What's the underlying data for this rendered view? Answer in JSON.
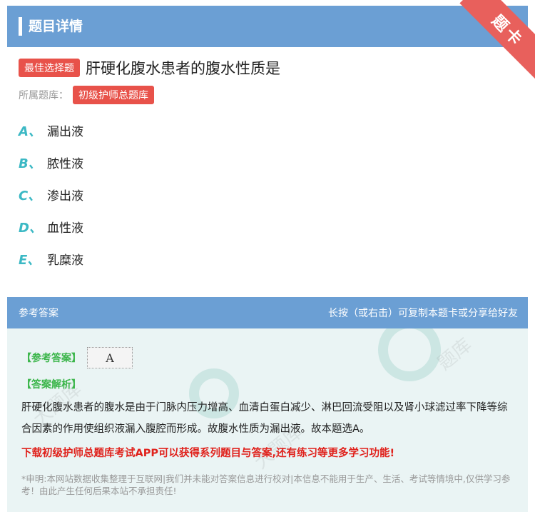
{
  "header": {
    "title": "题目详情",
    "corner_badge": "题卡"
  },
  "question": {
    "type_tag": "最佳选择题",
    "text": "肝硬化腹水患者的腹水性质是",
    "bank_label": "所属题库：",
    "bank_name": "初级护师总题库"
  },
  "options": [
    {
      "letter": "A、",
      "text": "漏出液"
    },
    {
      "letter": "B、",
      "text": "脓性液"
    },
    {
      "letter": "C、",
      "text": "渗出液"
    },
    {
      "letter": "D、",
      "text": "血性液"
    },
    {
      "letter": "E、",
      "text": "乳糜液"
    }
  ],
  "answer_section": {
    "title": "参考答案",
    "hint": "长按（或右击）可复制本题卡或分享给好友",
    "answer_label": "【参考答案】",
    "answer_value": "A",
    "analysis_label": "【答案解析】",
    "analysis_text": "肝硬化腹水患者的腹水是由于门脉内压力增高、血清白蛋白减少、淋巴回流受阻以及肾小球滤过率下降等综合因素的作用使组织液漏入腹腔而形成。故腹水性质为漏出液。故本题选A。",
    "download_text": "下载初级护师总题库考试APP可以获得系列题目与答案,还有练习等更多学习功能!",
    "disclaimer": "*申明:本网站数据收集整理于互联网|我们并未能对答案信息进行校对|本信息不能用于生产、生活、考试等情境中,仅供学习参考！由此产生任何后果本站不承担责任!"
  },
  "colors": {
    "header_bg": "#6b9fd4",
    "tag_red": "#e8524a",
    "option_letter": "#3bb8c4",
    "answer_green": "#3bb54a",
    "download_red": "#e0211b"
  }
}
